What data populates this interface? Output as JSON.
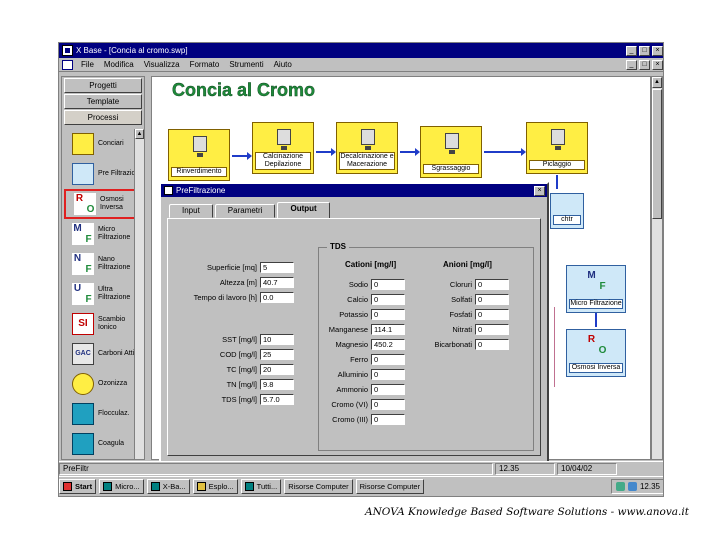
{
  "window": {
    "title": "X Base - [Concia al cromo.swp]",
    "min": "_",
    "max": "□",
    "close": "×"
  },
  "menu": [
    "File",
    "Modifica",
    "Visualizza",
    "Formato",
    "Strumenti",
    "Aiuto"
  ],
  "left_panel": {
    "tabs": [
      "Progetti",
      "Template",
      "Processi"
    ],
    "items": [
      {
        "label": "Conciari",
        "icon": "machine-icon"
      },
      {
        "label": "Pre Filtrazione",
        "icon": "filter-icon"
      },
      {
        "label": "Osmosi Inversa",
        "letters": [
          "R",
          "O"
        ],
        "icon": "ro-icon"
      },
      {
        "label": "Micro Filtrazione",
        "letters": [
          "M",
          "F"
        ],
        "icon": "mf-icon"
      },
      {
        "label": "Nano Filtrazione",
        "letters": [
          "N",
          "F"
        ],
        "icon": "nf-icon"
      },
      {
        "label": "Ultra Filtrazione",
        "letters": [
          "U",
          "F"
        ],
        "icon": "uf-icon"
      },
      {
        "label": "Scambio Ionico",
        "letters": [
          "SI"
        ],
        "icon": "si-icon"
      },
      {
        "label": "Carboni Attivi",
        "letters": [
          "GAC"
        ],
        "icon": "gac-icon"
      },
      {
        "label": "Ozonizza",
        "icon": "ozone-icon"
      },
      {
        "label": "Flocculaz.",
        "icon": "flocculation-icon"
      },
      {
        "label": "Coagula",
        "icon": "coagulation-icon"
      }
    ]
  },
  "canvas": {
    "title": "Concia al Cromo",
    "process": [
      "Rinverdimento",
      "Calcinazione Depilazione",
      "Decalcinazione e Macerazione",
      "Sgrassaggio",
      "Piclaggio"
    ],
    "side": [
      "Micro Filtrazione",
      "Osmosi Inversa"
    ],
    "stub_label": "chtr"
  },
  "dialog": {
    "title": "PreFiltrazione",
    "tabs": [
      "Input",
      "Parametri",
      "Output"
    ],
    "fields": [
      {
        "label": "Superficie [mq]",
        "value": "5"
      },
      {
        "label": "Altezza [m]",
        "value": "40.7"
      },
      {
        "label": "Tempo di lavoro [h]",
        "value": "0.0"
      },
      {
        "label": "SST [mg/l]",
        "value": "10"
      },
      {
        "label": "COD [mg/l]",
        "value": "25"
      },
      {
        "label": "TC [mg/l]",
        "value": "20"
      },
      {
        "label": "TN [mg/l]",
        "value": "9.8"
      },
      {
        "label": "TDS [mg/l]",
        "value": "5.7.0"
      }
    ],
    "tds": {
      "title": "TDS",
      "cation_head": "Cationi [mg/l]",
      "anion_head": "Anioni [mg/l]",
      "cations": [
        {
          "label": "Sodio",
          "value": "0"
        },
        {
          "label": "Calcio",
          "value": "0"
        },
        {
          "label": "Potassio",
          "value": "0"
        },
        {
          "label": "Manganese",
          "value": "114.1"
        },
        {
          "label": "Magnesio",
          "value": "450.2"
        },
        {
          "label": "Ferro",
          "value": "0"
        },
        {
          "label": "Alluminio",
          "value": "0"
        },
        {
          "label": "Ammonio",
          "value": "0"
        },
        {
          "label": "Cromo (VI)",
          "value": "0"
        },
        {
          "label": "Cromo (III)",
          "value": "0"
        }
      ],
      "anions": [
        {
          "label": "Cloruri",
          "value": "0"
        },
        {
          "label": "Solfati",
          "value": "0"
        },
        {
          "label": "Fosfati",
          "value": "0"
        },
        {
          "label": "Nitrati",
          "value": "0"
        },
        {
          "label": "Bicarbonati",
          "value": "0"
        }
      ]
    }
  },
  "statusbar": {
    "left": "PreFiltr",
    "time": "12.35",
    "date": "10/04/02"
  },
  "taskbar": {
    "start": "Start",
    "buttons": [
      "Micro...",
      "X-Ba...",
      "Esplo...",
      "Tutti...",
      "Risorse Computer",
      "Risorse Computer"
    ],
    "clock": "12.35"
  },
  "footer": "ANOVA Knowledge Based Software Solutions -  www.anova.it"
}
